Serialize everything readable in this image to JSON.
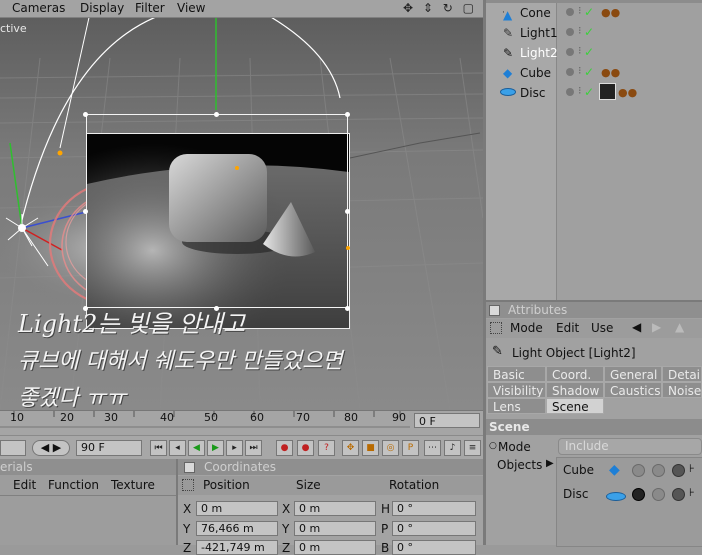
{
  "menubar": {
    "items": [
      "Cameras",
      "Display",
      "Filter",
      "View"
    ],
    "tools": "✥ ⇕ ↻ ▢"
  },
  "viewport": {
    "label": "ctive"
  },
  "overlay_text": [
    "Light2는 빛을 안내고",
    "큐브에 대해서 쉐도우만 만들었으면",
    "좋겠다 ㅠㅠ"
  ],
  "timeline": {
    "ticks": [
      "10",
      "20",
      "30",
      "40",
      "50",
      "60",
      "70",
      "80",
      "90"
    ],
    "current_frame": "0 F"
  },
  "transport": {
    "end_frame": "90 F"
  },
  "materials": {
    "title": "erials",
    "menu": [
      "Edit",
      "Function",
      "Texture"
    ]
  },
  "coordinates": {
    "title": "Coordinates",
    "headers": [
      "Position",
      "Size",
      "Rotation"
    ],
    "rows": [
      {
        "p_axis": "X",
        "p_val": "0 m",
        "s_axis": "X",
        "s_val": "0 m",
        "r_axis": "H",
        "r_val": "0 °"
      },
      {
        "p_axis": "Y",
        "p_val": "76,466 m",
        "s_axis": "Y",
        "s_val": "0 m",
        "r_axis": "P",
        "r_val": "0 °"
      },
      {
        "p_axis": "Z",
        "p_val": "-421,749 m",
        "s_axis": "Z",
        "s_val": "0 m",
        "r_axis": "B",
        "r_val": "0 °"
      }
    ]
  },
  "objects": [
    {
      "name": "Cone",
      "icon": "cone-icon",
      "tags": 2,
      "selected": false
    },
    {
      "name": "Light1",
      "icon": "light-icon",
      "tags": 0,
      "selected": false
    },
    {
      "name": "Light2",
      "icon": "light-icon",
      "tags": 0,
      "selected": true
    },
    {
      "name": "Cube",
      "icon": "cube-icon",
      "tags": 2,
      "selected": false
    },
    {
      "name": "Disc",
      "icon": "disc-icon",
      "tags": 3,
      "selected": false
    }
  ],
  "attributes": {
    "title": "Attributes",
    "menu": [
      "Mode",
      "Edit",
      "Use"
    ],
    "object_title": "Light Object [Light2]",
    "tabs_row1": [
      "Basic",
      "Coord.",
      "General",
      "Details"
    ],
    "tabs_row2": [
      "Visibility",
      "Shadow",
      "Caustics",
      "Noise"
    ],
    "tabs_row3": [
      "Lens",
      "Scene"
    ],
    "active_tab": "Scene",
    "section": "Scene",
    "mode_label": "Mode",
    "mode_value": "Include",
    "objects_label": "Objects",
    "object_list": [
      "Cube",
      "Disc"
    ]
  },
  "colors": {
    "accent_check": "#3bd13b",
    "selection": "#ffffff",
    "handle_orange": "#ffa500"
  }
}
